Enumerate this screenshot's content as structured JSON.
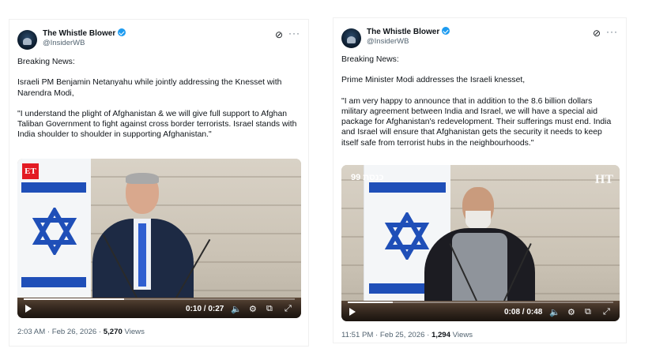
{
  "posts": [
    {
      "author_name": "The Whistle Blower",
      "handle": "@InsiderWB",
      "grok_icon": "⊘",
      "more_icon": "···",
      "text": "Breaking News:\n\nIsraeli PM Benjamin Netanyahu while jointly addressing the Knesset with Narendra Modi,\n\n\"I understand the plight of Afghanistan & we will give full support to Afghan Taliban Government to fight against cross border terrorists. Israel stands with India shoulder to shoulder in supporting Afghanistan.\"",
      "video": {
        "logo": "ET",
        "time": "0:10 / 0:27",
        "progress": 0.37
      },
      "timestamp": "2:03 AM · Feb 26, 2026 · ",
      "views_count": "5,270",
      "views_label": " Views"
    },
    {
      "author_name": "The Whistle Blower",
      "handle": "@InsiderWB",
      "grok_icon": "⊘",
      "more_icon": "···",
      "text": "Breaking News:\n\nPrime Minister Modi addresses the Israeli knesset,\n\n\"I am very happy to announce that in addition to the 8.6 billion dollars military agreement between India and Israel, we will have a special aid package for Afghanistan's redevelopment. Their sufferings must end. India and Israel will ensure that Afghanistan gets the security it needs to keep itself safe from terrorist hubs in the neighbourhoods.\"",
      "video": {
        "logo_left": "כנסת 99",
        "logo_right": "HT",
        "time": "0:08 / 0:48",
        "progress": 0.17
      },
      "timestamp": "11:51 PM · Feb 25, 2026 · ",
      "views_count": "1,294",
      "views_label": " Views"
    }
  ],
  "colors": {
    "verified": "#1d9bf0",
    "flag_blue": "#1f4fb8",
    "text": "#0f1419",
    "muted": "#536471"
  },
  "icons": [
    "verified-badge-icon",
    "grok-icon",
    "more-options-icon",
    "play-icon",
    "volume-icon",
    "settings-icon",
    "pip-icon",
    "fullscreen-icon"
  ]
}
